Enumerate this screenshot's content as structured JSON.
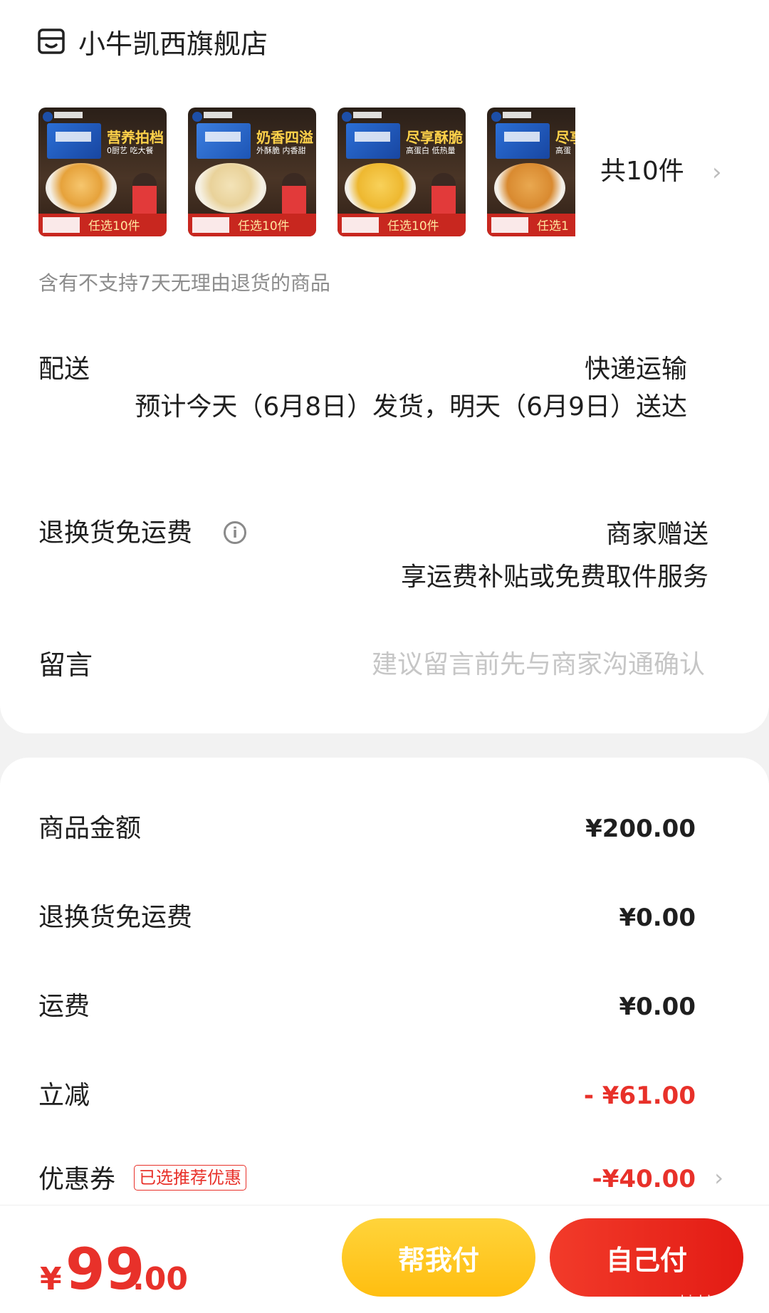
{
  "store": {
    "name": "小牛凯西旗舰店",
    "icon": "store-icon"
  },
  "items": {
    "thumbnails": [
      {
        "title": "营养拍档",
        "subtitle": "0厨艺 吃大餐",
        "tag": "任选10件"
      },
      {
        "title": "奶香四溢",
        "subtitle": "外酥脆 内香甜",
        "tag": "任选10件"
      },
      {
        "title": "尽享酥脆",
        "subtitle": "高蛋白 低热量",
        "tag": "任选10件"
      },
      {
        "title": "尽享",
        "subtitle": "高蛋",
        "tag": "任选1"
      }
    ],
    "count_label": "共10件",
    "chevron": "›"
  },
  "return_note": "含有不支持7天无理由退货的商品",
  "delivery": {
    "label": "配送",
    "method": "快递运输",
    "eta": "预计今天（6月8日）发货，明天（6月9日）送达"
  },
  "return_freight": {
    "label": "退换货免运费",
    "info_icon": "i",
    "value": "商家赠送",
    "desc": "享运费补贴或免费取件服务"
  },
  "message": {
    "label": "留言",
    "placeholder": "建议留言前先与商家沟通确认"
  },
  "summary": {
    "goods_label": "商品金额",
    "goods_value": "¥200.00",
    "rf_label": "退换货免运费",
    "rf_value": "¥0.00",
    "shipping_label": "运费",
    "shipping_value": "¥0.00",
    "discount_label": "立减",
    "discount_value": "- ¥61.00",
    "coupon_label": "优惠券",
    "coupon_badge": "已选推荐优惠",
    "coupon_value": "-¥40.00",
    "coupon_chevron": "›"
  },
  "footer": {
    "currency": "¥",
    "total_int": "99",
    "total_dec": ".00",
    "pay_friend": "帮我付",
    "pay_self": "自己付",
    "watermark": "zhizhizhi.com"
  },
  "colors": {
    "accent_red": "#e8312a",
    "accent_yellow": "#ffc61a"
  }
}
